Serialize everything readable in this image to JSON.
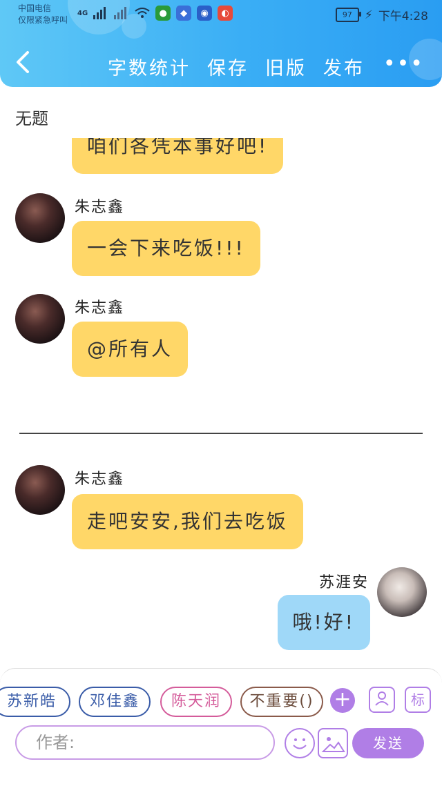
{
  "status_bar": {
    "carrier_line1": "中国电信",
    "carrier_line2": "仅限紧急呼叫",
    "signal": "4G",
    "battery": "97",
    "time": "下午4:28"
  },
  "header": {
    "back_icon": "chevron-left-icon",
    "actions": [
      "字数统计",
      "保存",
      "旧版",
      "发布"
    ],
    "more_icon": "more-dots-icon",
    "more_label": "•••"
  },
  "document": {
    "title": "无题"
  },
  "chat": {
    "messages": [
      {
        "sender": "",
        "text": "咱们各凭本事好吧!"
      },
      {
        "sender": "朱志鑫",
        "text": "一会下来吃饭!!!"
      },
      {
        "sender": "朱志鑫",
        "text": "@所有人"
      },
      {
        "sender": "朱志鑫",
        "text": "走吧安安,我们去吃饭"
      },
      {
        "sender": "苏涯安",
        "text": "哦!好!"
      }
    ]
  },
  "composer": {
    "characters": [
      "苏新皓",
      "邓佳鑫",
      "陈天润",
      "不重要()"
    ],
    "add_label": "+",
    "person_icon_label": "人",
    "tag_label": "标",
    "author_placeholder": "作者:",
    "emoji_icon": "smiley-icon",
    "image_icon": "image-icon",
    "send_label": "发送"
  },
  "colors": {
    "header_gradient_start": "#5fc8f6",
    "header_gradient_end": "#2a9df2",
    "bubble_yellow": "#ffd768",
    "bubble_blue": "#9fd8f8",
    "accent_purple": "#b07ee6"
  }
}
